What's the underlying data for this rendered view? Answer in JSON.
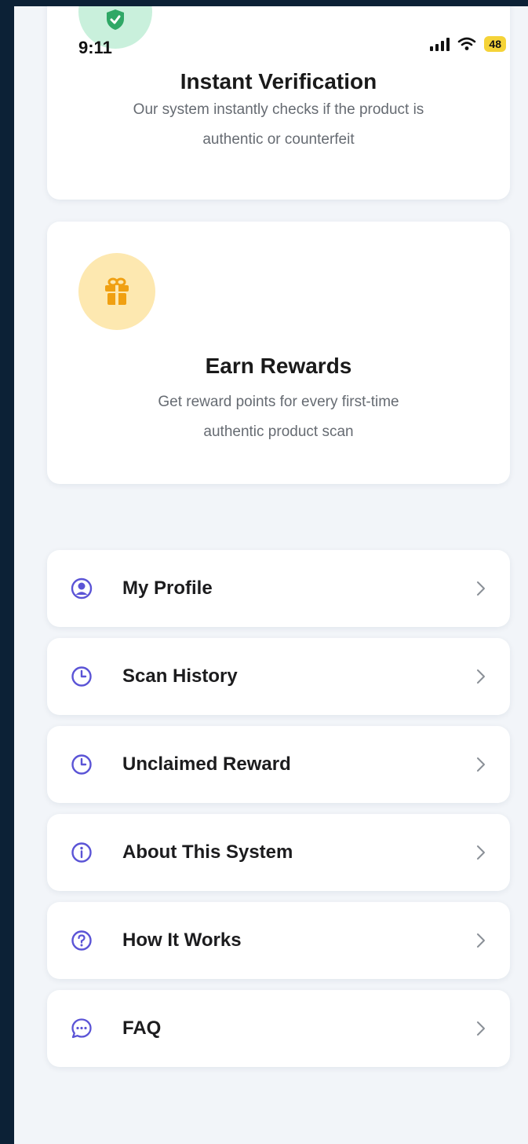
{
  "status_bar": {
    "time": "9:11",
    "battery": "48",
    "icons": [
      "signal-icon",
      "wifi-icon",
      "battery-icon"
    ]
  },
  "feature_cards": [
    {
      "icon": "shield-check-icon",
      "title": "Instant Verification",
      "description_line1": "Our system instantly checks if the product is",
      "description_line2": "authentic or counterfeit"
    },
    {
      "icon": "gift-icon",
      "title": "Earn Rewards",
      "description_line1": "Get reward points for every first-time",
      "description_line2": "authentic product scan"
    }
  ],
  "menu": {
    "items": [
      {
        "label": "My Profile",
        "icon": "user-circle-icon"
      },
      {
        "label": "Scan History",
        "icon": "clock-icon"
      },
      {
        "label": "Unclaimed Reward",
        "icon": "clock-icon"
      },
      {
        "label": "About This System",
        "icon": "info-icon"
      },
      {
        "label": "How It Works",
        "icon": "question-icon"
      },
      {
        "label": "FAQ",
        "icon": "chat-bubble-icon"
      }
    ]
  },
  "colors": {
    "accent": "#5b54d6",
    "shield_green": "#2fa866",
    "gift_orange": "#f0a012",
    "battery_yellow": "#f5d338",
    "background": "#f2f5f9"
  }
}
